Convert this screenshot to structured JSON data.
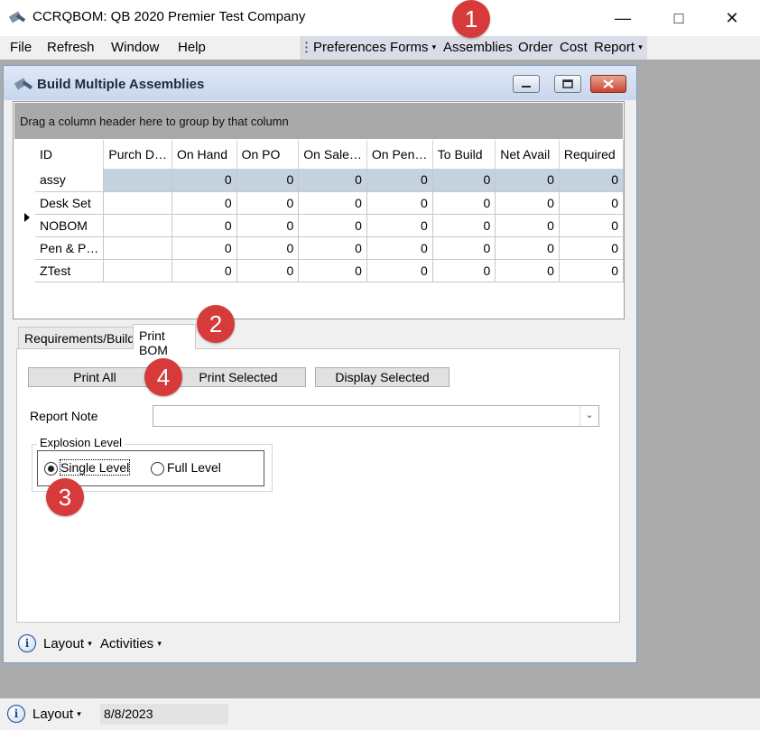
{
  "window": {
    "title": "CCRQBOM: QB 2020 Premier Test Company"
  },
  "menubar": {
    "left": [
      "File",
      "Refresh",
      "Window",
      "Help"
    ],
    "right": [
      "Preferences",
      "Forms",
      "Assemblies",
      "Order",
      "Cost",
      "Report"
    ]
  },
  "child": {
    "title": "Build Multiple Assemblies",
    "group_hint": "Drag a column header here to group by that column",
    "columns": [
      "ID",
      "Purch D…",
      "On Hand",
      "On PO",
      "On Sale…",
      "On Pen…",
      "To Build",
      "Net Avail",
      "Required"
    ],
    "rows": [
      {
        "id": "assy",
        "purch": "",
        "values": [
          "0",
          "0",
          "0",
          "0",
          "0",
          "0",
          "0"
        ]
      },
      {
        "id": "Desk Set",
        "purch": "",
        "values": [
          "0",
          "0",
          "0",
          "0",
          "0",
          "0",
          "0"
        ]
      },
      {
        "id": "NOBOM",
        "purch": "",
        "values": [
          "0",
          "0",
          "0",
          "0",
          "0",
          "0",
          "0"
        ]
      },
      {
        "id": "Pen & P…",
        "purch": "",
        "values": [
          "0",
          "0",
          "0",
          "0",
          "0",
          "0",
          "0"
        ]
      },
      {
        "id": "ZTest",
        "purch": "",
        "values": [
          "0",
          "0",
          "0",
          "0",
          "0",
          "0",
          "0"
        ]
      }
    ],
    "tabs": [
      "Requirements/Build",
      "Print BOM"
    ],
    "buttons": {
      "print_all": "Print All",
      "print_selected": "Print Selected",
      "display_selected": "Display Selected"
    },
    "report_note": {
      "label": "Report Note",
      "value": ""
    },
    "explosion": {
      "legend": "Explosion Level",
      "single": "Single Level",
      "full": "Full Level",
      "selected": "single"
    },
    "footer": {
      "layout": "Layout",
      "activities": "Activities"
    }
  },
  "statusbar": {
    "layout": "Layout",
    "date": "8/8/2023"
  },
  "badges": [
    "1",
    "2",
    "3",
    "4"
  ],
  "colors": {
    "badge": "#d63a3a",
    "selection": "#c4d1df",
    "mdi_bg": "#ababab"
  }
}
